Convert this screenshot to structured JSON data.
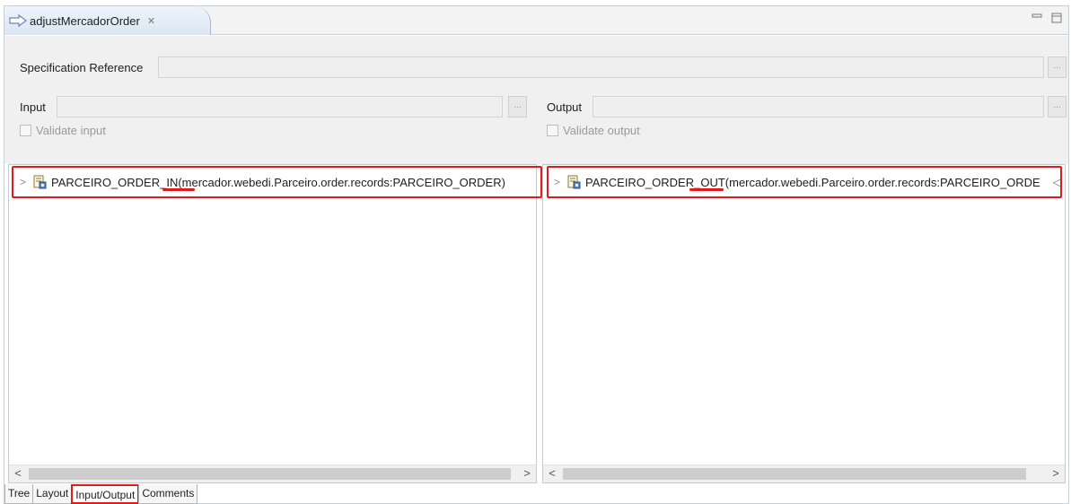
{
  "editor": {
    "tab_title": "adjustMercadorOrder",
    "tab_close": "✕"
  },
  "form": {
    "spec_label": "Specification Reference",
    "spec_value": "",
    "browse_label": "...",
    "input_label": "Input",
    "input_value": "",
    "output_label": "Output",
    "output_value": "",
    "validate_input_label": "Validate input",
    "validate_output_label": "Validate output"
  },
  "input_tree": {
    "name_prefix": "PARCEIRO_ORDER_",
    "name_suffix": "IN",
    "type": " (mercador.webedi.Parceiro.order.records:PARCEIRO_ORDER)"
  },
  "output_tree": {
    "name_prefix": "PARCEIRO_ORDER_",
    "name_suffix": "OUT",
    "type": " (mercador.webedi.Parceiro.order.records:PARCEIRO_ORDE"
  },
  "bottom_tabs": [
    "Tree",
    "Layout",
    "Input/Output",
    "Comments"
  ],
  "active_bottom_tab": "Input/Output",
  "colors": {
    "highlight": "#e01b1b",
    "tab_gradient_top": "#eef4fb",
    "tab_gradient_bottom": "#dbe6f3"
  },
  "icons": [
    "input-output-arrow-icon",
    "record-document-icon",
    "minimize-icon",
    "maximize-icon",
    "chevron-right-icon",
    "chevron-left-icon"
  ]
}
